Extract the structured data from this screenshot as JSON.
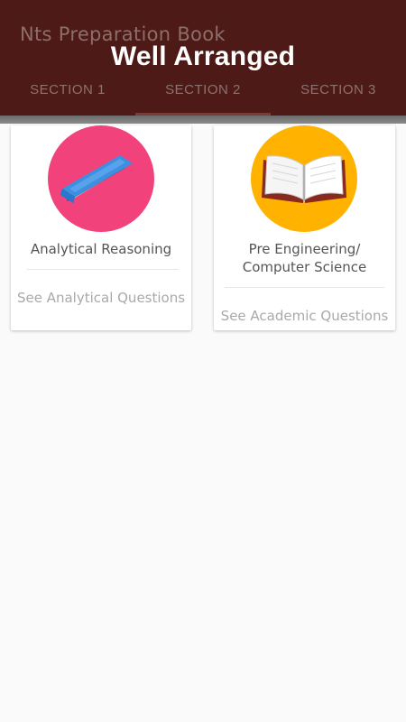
{
  "appbar": {
    "title": "Nts Preparation Book",
    "banner": "Well Arranged",
    "tabs": [
      {
        "label": "SECTION 1"
      },
      {
        "label": "SECTION 2"
      },
      {
        "label": "SECTION 3"
      }
    ],
    "selected_tab": 2,
    "color": "#4e1a17"
  },
  "cards": [
    {
      "title": "Analytical Reasoning",
      "link": "See Analytical Questions",
      "icon": "closed-book-icon",
      "circle_color": "#f2427b"
    },
    {
      "title": "Pre Engineering/ Computer Science",
      "link": "See Academic Questions",
      "icon": "open-book-icon",
      "circle_color": "#ffb300"
    }
  ]
}
